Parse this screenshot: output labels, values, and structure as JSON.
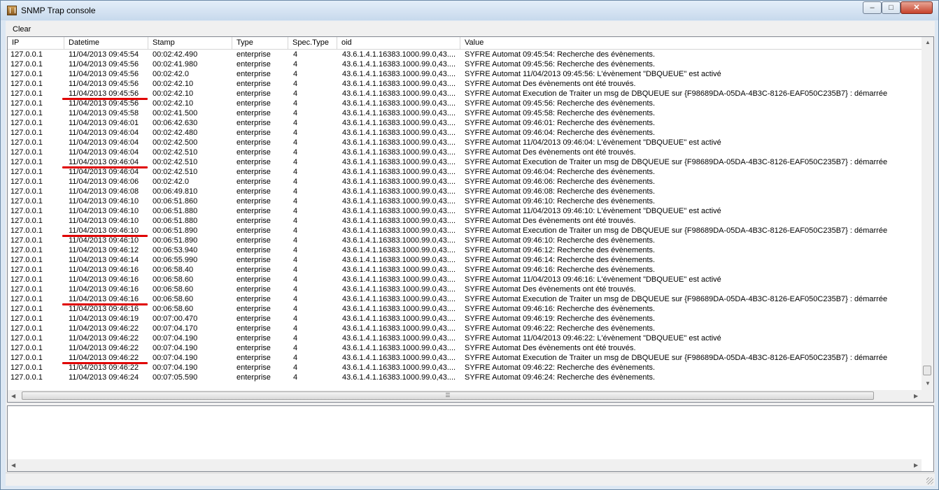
{
  "window": {
    "title": "SNMP Trap console"
  },
  "menu": {
    "clear": "Clear"
  },
  "columns": {
    "ip": "IP",
    "datetime": "Datetime",
    "stamp": "Stamp",
    "type": "Type",
    "spec_type": "Spec.Type",
    "oid": "oid",
    "value": "Value"
  },
  "rows": [
    [
      "127.0.0.1",
      "11/04/2013 09:45:54",
      "00:02:42.490",
      "enterprise",
      "4",
      "43.6.1.4.1.16383.1000.99.0,43....",
      "SYFRE Automat 09:45:54: Recherche des évènements."
    ],
    [
      "127.0.0.1",
      "11/04/2013 09:45:56",
      "00:02:41.980",
      "enterprise",
      "4",
      "43.6.1.4.1.16383.1000.99.0,43....",
      "SYFRE Automat 09:45:56: Recherche des évènements."
    ],
    [
      "127.0.0.1",
      "11/04/2013 09:45:56",
      "00:02:42.0",
      "enterprise",
      "4",
      "43.6.1.4.1.16383.1000.99.0,43....",
      "SYFRE Automat 11/04/2013 09:45:56: L'évènement \"DBQUEUE\" est activé"
    ],
    [
      "127.0.0.1",
      "11/04/2013 09:45:56",
      "00:02:42.10",
      "enterprise",
      "4",
      "43.6.1.4.1.16383.1000.99.0,43....",
      "SYFRE Automat Des évènements ont été trouvés."
    ],
    [
      "127.0.0.1",
      "11/04/2013 09:45:56",
      "00:02:42.10",
      "enterprise",
      "4",
      "43.6.1.4.1.16383.1000.99.0,43....",
      "SYFRE Automat Execution de Traiter un msg de DBQUEUE sur {F98689DA-05DA-4B3C-8126-EAF050C235B7} : démarrée"
    ],
    [
      "127.0.0.1",
      "11/04/2013 09:45:56",
      "00:02:42.10",
      "enterprise",
      "4",
      "43.6.1.4.1.16383.1000.99.0,43....",
      "SYFRE Automat 09:45:56: Recherche des évènements."
    ],
    [
      "127.0.0.1",
      "11/04/2013 09:45:58",
      "00:02:41.500",
      "enterprise",
      "4",
      "43.6.1.4.1.16383.1000.99.0,43....",
      "SYFRE Automat 09:45:58: Recherche des évènements."
    ],
    [
      "127.0.0.1",
      "11/04/2013 09:46:01",
      "00:06:42.630",
      "enterprise",
      "4",
      "43.6.1.4.1.16383.1000.99.0,43....",
      "SYFRE Automat 09:46:01: Recherche des évènements."
    ],
    [
      "127.0.0.1",
      "11/04/2013 09:46:04",
      "00:02:42.480",
      "enterprise",
      "4",
      "43.6.1.4.1.16383.1000.99.0,43....",
      "SYFRE Automat 09:46:04: Recherche des évènements."
    ],
    [
      "127.0.0.1",
      "11/04/2013 09:46:04",
      "00:02:42.500",
      "enterprise",
      "4",
      "43.6.1.4.1.16383.1000.99.0,43....",
      "SYFRE Automat 11/04/2013 09:46:04: L'évènement \"DBQUEUE\" est activé"
    ],
    [
      "127.0.0.1",
      "11/04/2013 09:46:04",
      "00:02:42.510",
      "enterprise",
      "4",
      "43.6.1.4.1.16383.1000.99.0,43....",
      "SYFRE Automat Des évènements ont été trouvés."
    ],
    [
      "127.0.0.1",
      "11/04/2013 09:46:04",
      "00:02:42.510",
      "enterprise",
      "4",
      "43.6.1.4.1.16383.1000.99.0,43....",
      "SYFRE Automat Execution de Traiter un msg de DBQUEUE sur {F98689DA-05DA-4B3C-8126-EAF050C235B7} : démarrée"
    ],
    [
      "127.0.0.1",
      "11/04/2013 09:46:04",
      "00:02:42.510",
      "enterprise",
      "4",
      "43.6.1.4.1.16383.1000.99.0,43....",
      "SYFRE Automat 09:46:04: Recherche des évènements."
    ],
    [
      "127.0.0.1",
      "11/04/2013 09:46:06",
      "00:02:42.0",
      "enterprise",
      "4",
      "43.6.1.4.1.16383.1000.99.0,43....",
      "SYFRE Automat 09:46:06: Recherche des évènements."
    ],
    [
      "127.0.0.1",
      "11/04/2013 09:46:08",
      "00:06:49.810",
      "enterprise",
      "4",
      "43.6.1.4.1.16383.1000.99.0,43....",
      "SYFRE Automat 09:46:08: Recherche des évènements."
    ],
    [
      "127.0.0.1",
      "11/04/2013 09:46:10",
      "00:06:51.860",
      "enterprise",
      "4",
      "43.6.1.4.1.16383.1000.99.0,43....",
      "SYFRE Automat 09:46:10: Recherche des évènements."
    ],
    [
      "127.0.0.1",
      "11/04/2013 09:46:10",
      "00:06:51.880",
      "enterprise",
      "4",
      "43.6.1.4.1.16383.1000.99.0,43....",
      "SYFRE Automat 11/04/2013 09:46:10: L'évènement \"DBQUEUE\" est activé"
    ],
    [
      "127.0.0.1",
      "11/04/2013 09:46:10",
      "00:06:51.880",
      "enterprise",
      "4",
      "43.6.1.4.1.16383.1000.99.0,43....",
      "SYFRE Automat Des évènements ont été trouvés."
    ],
    [
      "127.0.0.1",
      "11/04/2013 09:46:10",
      "00:06:51.890",
      "enterprise",
      "4",
      "43.6.1.4.1.16383.1000.99.0,43....",
      "SYFRE Automat Execution de Traiter un msg de DBQUEUE sur {F98689DA-05DA-4B3C-8126-EAF050C235B7} : démarrée"
    ],
    [
      "127.0.0.1",
      "11/04/2013 09:46:10",
      "00:06:51.890",
      "enterprise",
      "4",
      "43.6.1.4.1.16383.1000.99.0,43....",
      "SYFRE Automat 09:46:10: Recherche des évènements."
    ],
    [
      "127.0.0.1",
      "11/04/2013 09:46:12",
      "00:06:53.940",
      "enterprise",
      "4",
      "43.6.1.4.1.16383.1000.99.0,43....",
      "SYFRE Automat 09:46:12: Recherche des évènements."
    ],
    [
      "127.0.0.1",
      "11/04/2013 09:46:14",
      "00:06:55.990",
      "enterprise",
      "4",
      "43.6.1.4.1.16383.1000.99.0,43....",
      "SYFRE Automat 09:46:14: Recherche des évènements."
    ],
    [
      "127.0.0.1",
      "11/04/2013 09:46:16",
      "00:06:58.40",
      "enterprise",
      "4",
      "43.6.1.4.1.16383.1000.99.0,43....",
      "SYFRE Automat 09:46:16: Recherche des évènements."
    ],
    [
      "127.0.0.1",
      "11/04/2013 09:46:16",
      "00:06:58.60",
      "enterprise",
      "4",
      "43.6.1.4.1.16383.1000.99.0,43....",
      "SYFRE Automat 11/04/2013 09:46:16: L'évènement \"DBQUEUE\" est activé"
    ],
    [
      "127.0.0.1",
      "11/04/2013 09:46:16",
      "00:06:58.60",
      "enterprise",
      "4",
      "43.6.1.4.1.16383.1000.99.0,43....",
      "SYFRE Automat Des évènements ont été trouvés."
    ],
    [
      "127.0.0.1",
      "11/04/2013 09:46:16",
      "00:06:58.60",
      "enterprise",
      "4",
      "43.6.1.4.1.16383.1000.99.0,43....",
      "SYFRE Automat Execution de Traiter un msg de DBQUEUE sur {F98689DA-05DA-4B3C-8126-EAF050C235B7} : démarrée"
    ],
    [
      "127.0.0.1",
      "11/04/2013 09:46:16",
      "00:06:58.60",
      "enterprise",
      "4",
      "43.6.1.4.1.16383.1000.99.0,43....",
      "SYFRE Automat 09:46:16: Recherche des évènements."
    ],
    [
      "127.0.0.1",
      "11/04/2013 09:46:19",
      "00:07:00.470",
      "enterprise",
      "4",
      "43.6.1.4.1.16383.1000.99.0,43....",
      "SYFRE Automat 09:46:19: Recherche des évènements."
    ],
    [
      "127.0.0.1",
      "11/04/2013 09:46:22",
      "00:07:04.170",
      "enterprise",
      "4",
      "43.6.1.4.1.16383.1000.99.0,43....",
      "SYFRE Automat 09:46:22: Recherche des évènements."
    ],
    [
      "127.0.0.1",
      "11/04/2013 09:46:22",
      "00:07:04.190",
      "enterprise",
      "4",
      "43.6.1.4.1.16383.1000.99.0,43....",
      "SYFRE Automat 11/04/2013 09:46:22: L'évènement \"DBQUEUE\" est activé"
    ],
    [
      "127.0.0.1",
      "11/04/2013 09:46:22",
      "00:07:04.190",
      "enterprise",
      "4",
      "43.6.1.4.1.16383.1000.99.0,43....",
      "SYFRE Automat Des évènements ont été trouvés."
    ],
    [
      "127.0.0.1",
      "11/04/2013 09:46:22",
      "00:07:04.190",
      "enterprise",
      "4",
      "43.6.1.4.1.16383.1000.99.0,43....",
      "SYFRE Automat Execution de Traiter un msg de DBQUEUE sur {F98689DA-05DA-4B3C-8126-EAF050C235B7} : démarrée"
    ],
    [
      "127.0.0.1",
      "11/04/2013 09:46:22",
      "00:07:04.190",
      "enterprise",
      "4",
      "43.6.1.4.1.16383.1000.99.0,43....",
      "SYFRE Automat 09:46:22: Recherche des évènements."
    ],
    [
      "127.0.0.1",
      "11/04/2013 09:46:24",
      "00:07:05.590",
      "enterprise",
      "4",
      "43.6.1.4.1.16383.1000.99.0,43....",
      "SYFRE Automat 09:46:24: Recherche des évènements."
    ]
  ],
  "highlighted_rows": [
    4,
    11,
    18,
    25,
    31
  ],
  "annotation_color": "#e00000",
  "icons": {
    "app": "snmp-app-icon",
    "minimize": "minimize-icon",
    "maximize": "maximize-icon",
    "close": "close-icon",
    "scroll_grip": "grip-icon"
  }
}
